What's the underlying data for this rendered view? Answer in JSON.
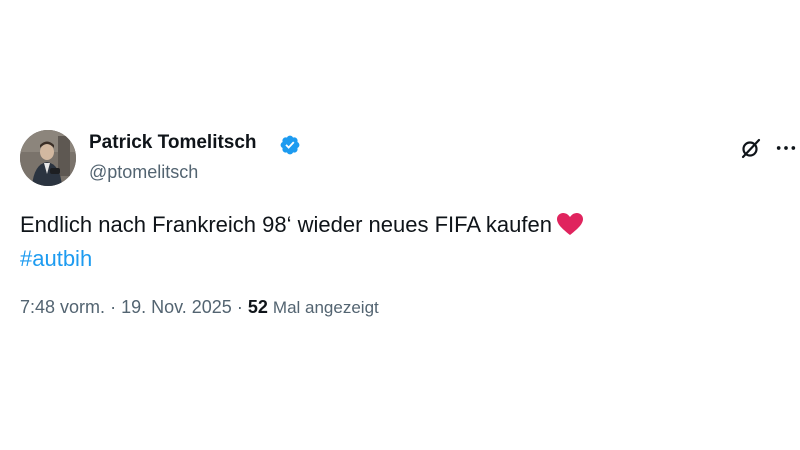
{
  "author": {
    "name": "Patrick Tomelitsch",
    "handle": "@ptomelitsch",
    "verified_icon": "verified-badge-icon",
    "verified_color": "#1d9bf0"
  },
  "tweet": {
    "text": "Endlich nach Frankreich 98‘ wieder neues FIFA kaufen",
    "emoji_icon": "red-heart-icon",
    "hashtag": "#autbih"
  },
  "meta": {
    "time": "7:48 vorm.",
    "separator": "·",
    "date": "19. Nov. 2025",
    "views_count": "52",
    "views_label": "Mal angezeigt"
  },
  "actions": {
    "grok_icon": "grok-icon",
    "more_icon": "more-options-icon"
  },
  "colors": {
    "text": "#0f1419",
    "secondary": "#536471",
    "link": "#1d9bf0",
    "heart": "#e0245e"
  }
}
